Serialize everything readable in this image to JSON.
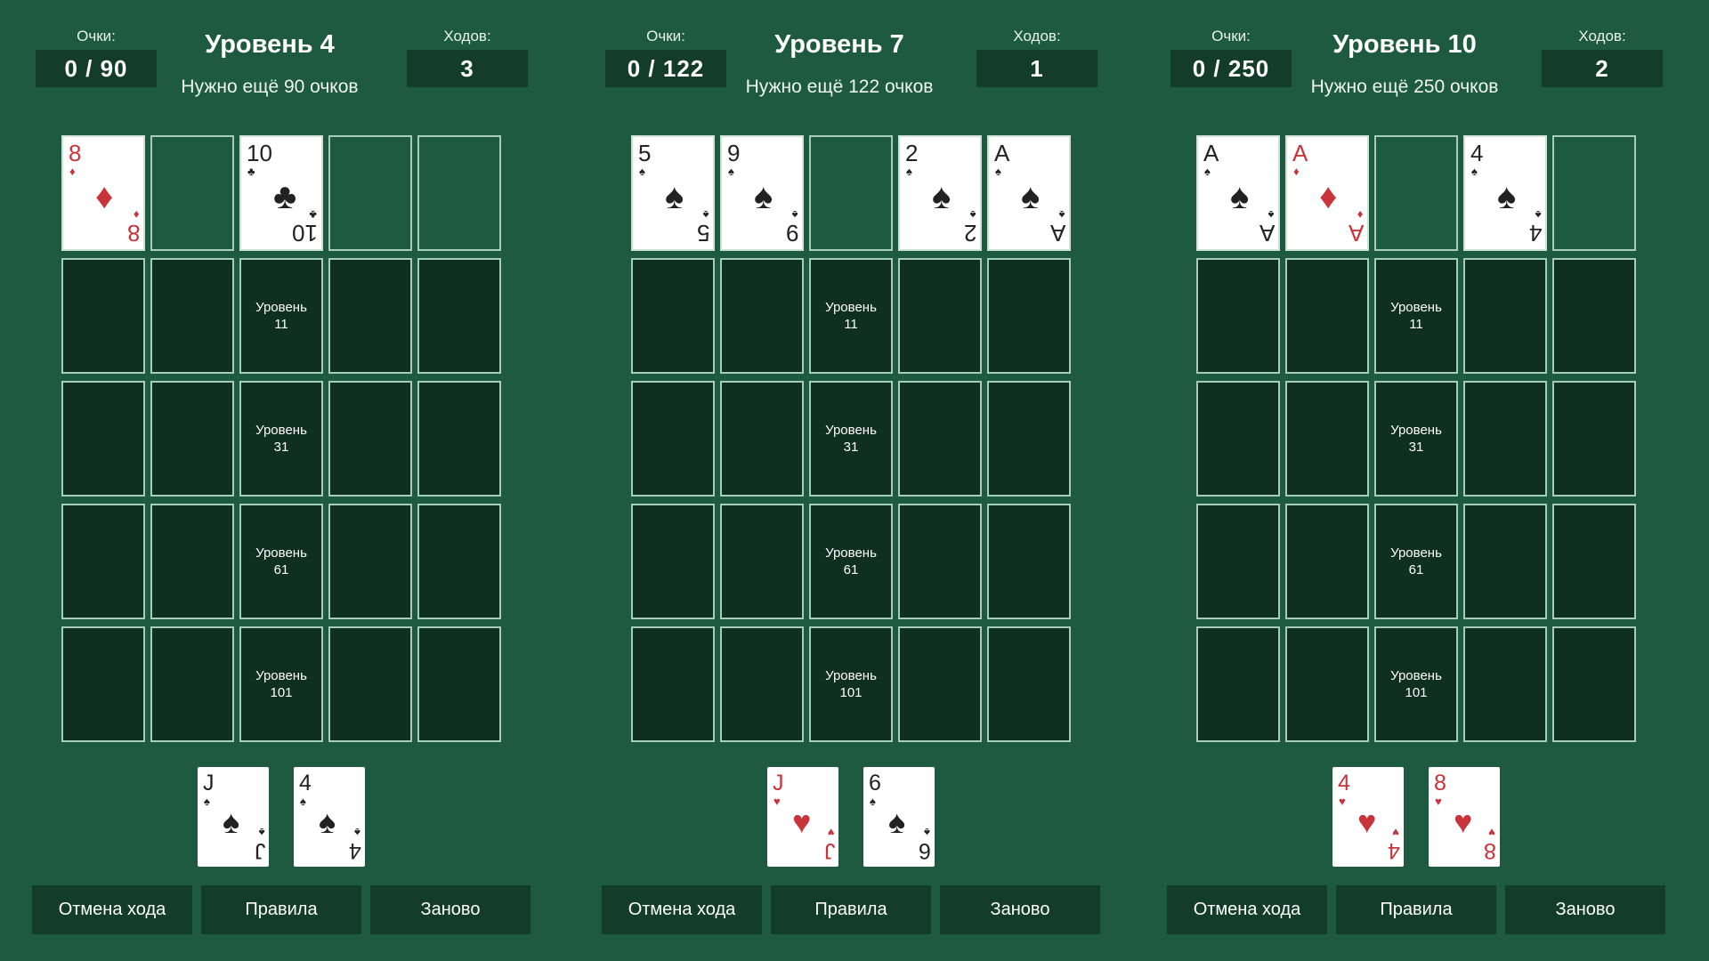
{
  "labels": {
    "score_label": "Очки:",
    "moves_label": "Ходов:",
    "undo": "Отмена хода",
    "rules": "Правила",
    "restart": "Заново"
  },
  "panels": [
    {
      "score": "0 / 90",
      "title": "Уровень 4",
      "need": "Нужно ещё 90 очков",
      "moves": "3",
      "top_row": [
        {
          "rank": "8",
          "suit": "♦",
          "color": "red"
        },
        null,
        {
          "rank": "10",
          "suit": "♣",
          "color": "black"
        },
        null,
        null
      ],
      "hand": [
        {
          "rank": "J",
          "suit": "♠",
          "color": "black"
        },
        {
          "rank": "4",
          "suit": "♠",
          "color": "black"
        }
      ]
    },
    {
      "score": "0 / 122",
      "title": "Уровень 7",
      "need": "Нужно ещё 122 очков",
      "moves": "1",
      "top_row": [
        {
          "rank": "5",
          "suit": "♠",
          "color": "black"
        },
        {
          "rank": "9",
          "suit": "♠",
          "color": "black"
        },
        null,
        {
          "rank": "2",
          "suit": "♠",
          "color": "black"
        },
        {
          "rank": "A",
          "suit": "♠",
          "color": "black"
        }
      ],
      "hand": [
        {
          "rank": "J",
          "suit": "♥",
          "color": "red"
        },
        {
          "rank": "6",
          "suit": "♠",
          "color": "black"
        }
      ]
    },
    {
      "score": "0 / 250",
      "title": "Уровень 10",
      "need": "Нужно ещё 250 очков",
      "moves": "2",
      "top_row": [
        {
          "rank": "A",
          "suit": "♠",
          "color": "black"
        },
        {
          "rank": "A",
          "suit": "♦",
          "color": "red"
        },
        null,
        {
          "rank": "4",
          "suit": "♠",
          "color": "black"
        },
        null
      ],
      "hand": [
        {
          "rank": "4",
          "suit": "♥",
          "color": "red"
        },
        {
          "rank": "8",
          "suit": "♥",
          "color": "red"
        }
      ]
    }
  ],
  "bonus_rows": [
    {
      "word": "Уровень",
      "num": "11"
    },
    {
      "word": "Уровень",
      "num": "31"
    },
    {
      "word": "Уровень",
      "num": "61"
    },
    {
      "word": "Уровень",
      "num": "101"
    }
  ],
  "colors": {
    "table": "#1e5a3f",
    "slot": "#0f2f22",
    "panel_box": "#133d2a",
    "red_suit": "#c9333a",
    "black_suit": "#222222"
  }
}
